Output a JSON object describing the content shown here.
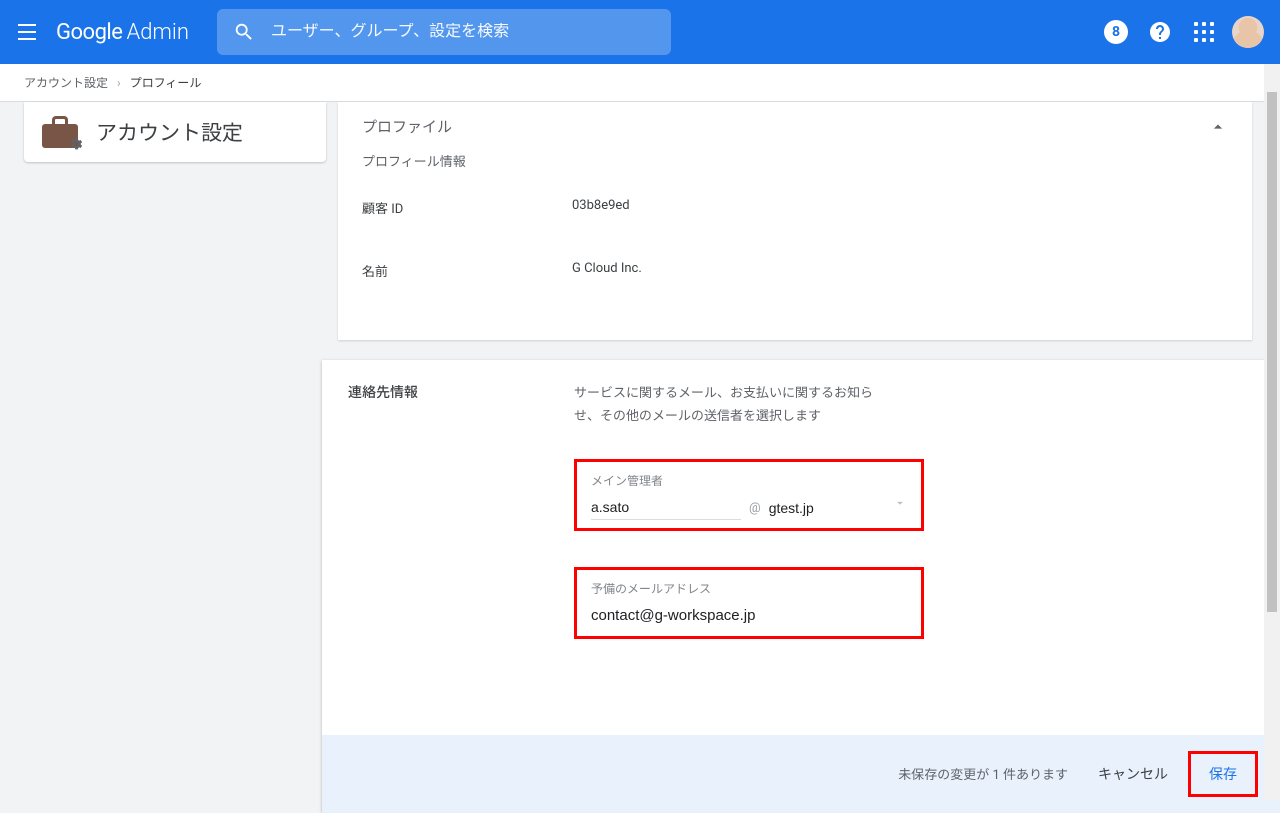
{
  "header": {
    "logo_google": "Google",
    "logo_admin": "Admin",
    "search_placeholder": "ユーザー、グループ、設定を検索",
    "badge_char": "8"
  },
  "breadcrumb": {
    "root": "アカウント設定",
    "sep": "›",
    "current": "プロフィール"
  },
  "sidebar": {
    "title": "アカウント設定"
  },
  "profile_panel": {
    "title": "プロファイル",
    "subtitle": "プロフィール情報",
    "rows": [
      {
        "label": "顧客 ID",
        "value": "03b8e9ed"
      },
      {
        "label": "名前",
        "value": "G Cloud Inc."
      }
    ]
  },
  "contact_panel": {
    "title": "連絡先情報",
    "description": "サービスに関するメール、お支払いに関するお知らせ、その他のメールの送信者を選択します",
    "primary": {
      "label": "メイン管理者",
      "user": "a.sato",
      "at": "@",
      "domain": "gtest.jp"
    },
    "backup": {
      "label": "予備のメールアドレス",
      "value": "contact@g-workspace.jp"
    }
  },
  "footer": {
    "message": "未保存の変更が 1 件あります",
    "cancel": "キャンセル",
    "save": "保存"
  }
}
